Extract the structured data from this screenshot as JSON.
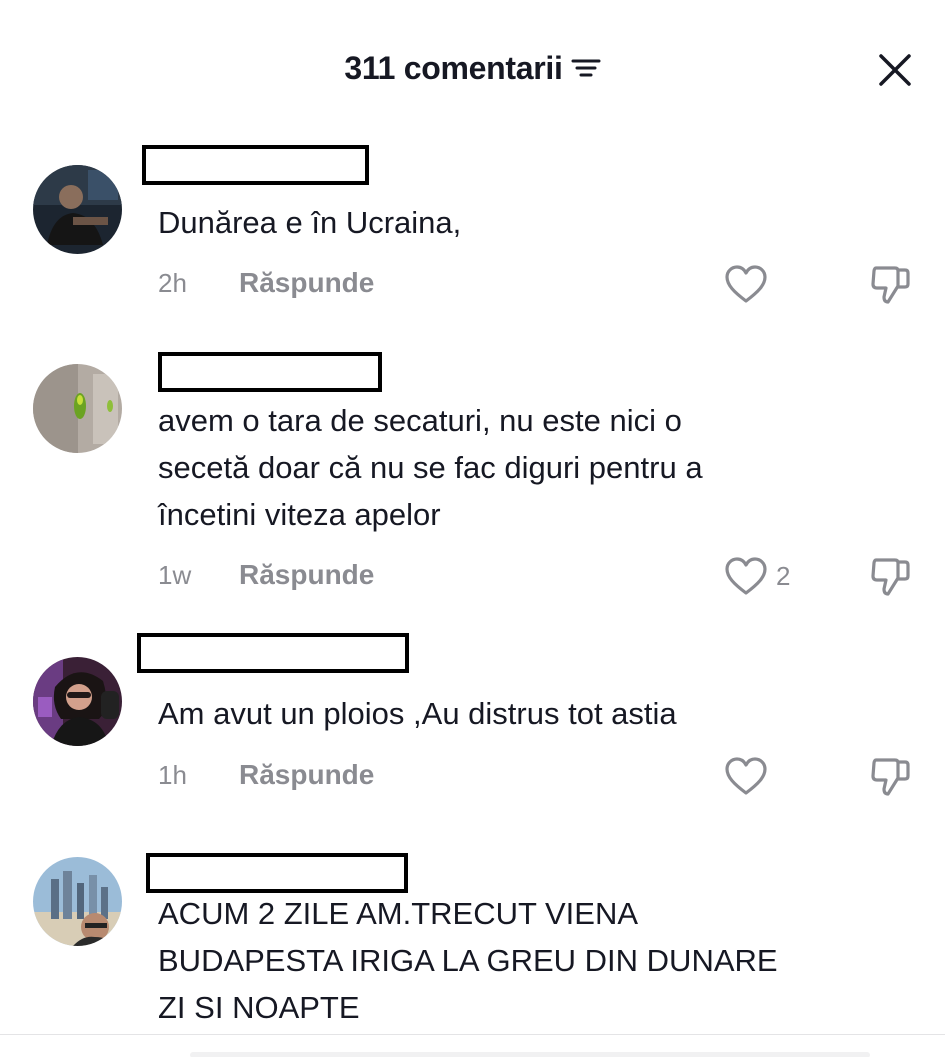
{
  "header": {
    "title": "311 comentarii",
    "sort_icon": "sort-lines-icon",
    "close_icon": "close-icon"
  },
  "reply_label": "Răspunde",
  "colors": {
    "text": "#161823",
    "secondary": "#8a8b91",
    "background": "#ffffff"
  },
  "comments": [
    {
      "text": "Dunărea e în Ucraina,",
      "time": "2h",
      "likes": ""
    },
    {
      "text_lines": [
        "avem o tara de secaturi, nu este nici o",
        "secetă doar că nu se fac diguri pentru a",
        "încetini viteza apelor"
      ],
      "time": "1w",
      "likes": "2"
    },
    {
      "text": "Am avut un ploios ,Au distrus tot astia",
      "time": "1h",
      "likes": ""
    },
    {
      "text_lines": [
        "ACUM 2 ZILE AM.TRECUT VIENA",
        "BUDAPESTA IRIGA LA GREU DIN DUNARE",
        "ZI SI NOAPTE"
      ],
      "time": "",
      "likes": ""
    }
  ]
}
